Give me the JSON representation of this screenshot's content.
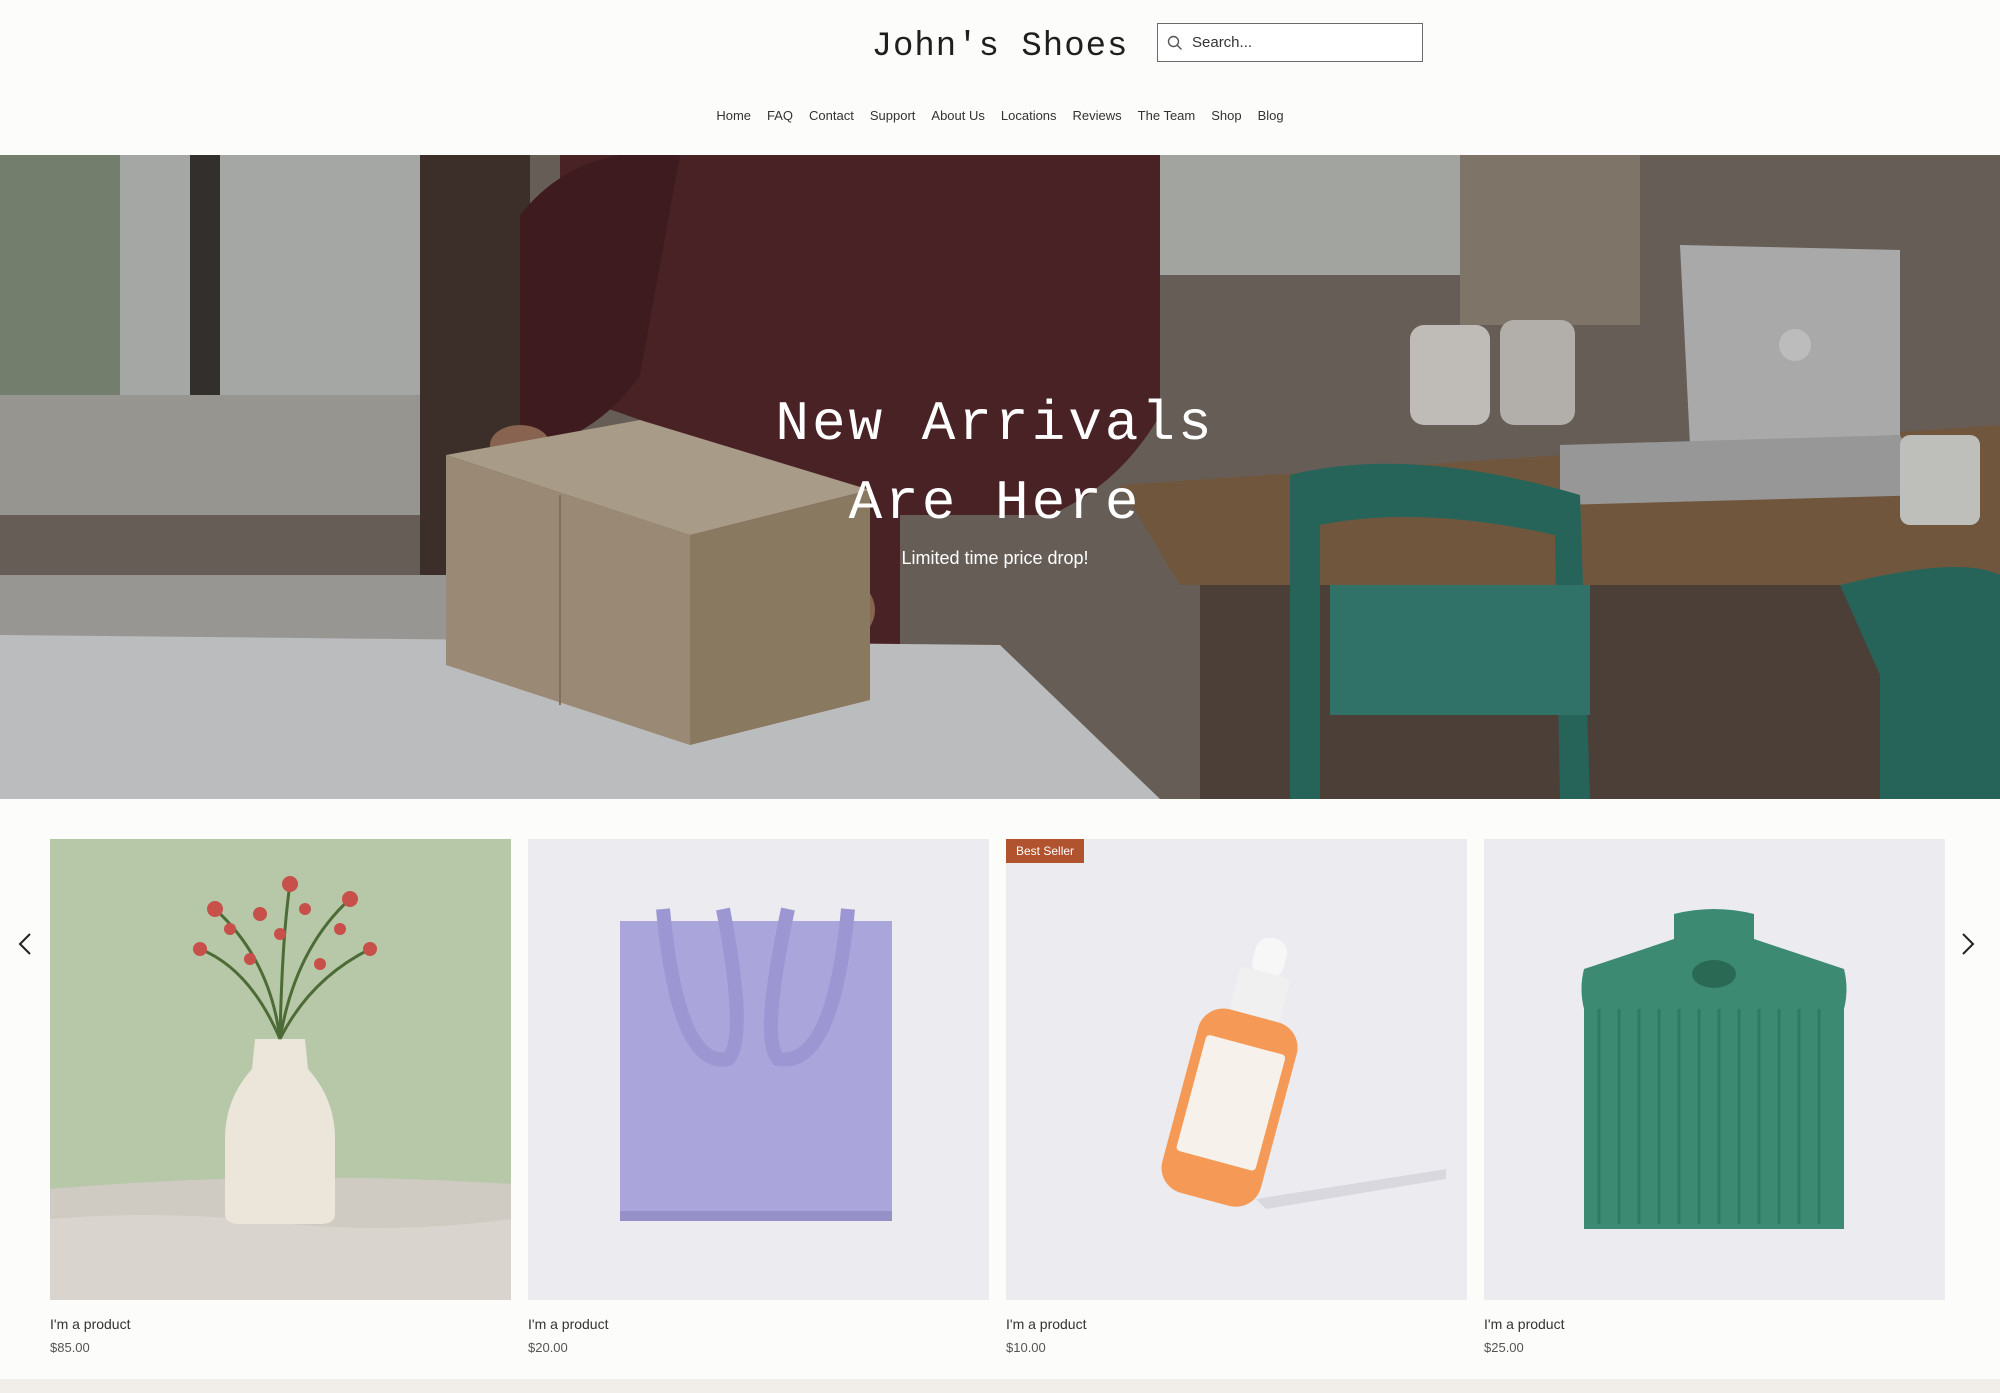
{
  "header": {
    "brand": "John's Shoes",
    "search_placeholder": "Search..."
  },
  "nav": [
    "Home",
    "FAQ",
    "Contact",
    "Support",
    "About Us",
    "Locations",
    "Reviews",
    "The Team",
    "Shop",
    "Blog"
  ],
  "hero": {
    "title": "New Arrivals\nAre Here",
    "subtitle": "Limited time price drop!"
  },
  "products": [
    {
      "name": "I'm a product",
      "price": "$85.00",
      "badge": "",
      "image": "vase-with-flowers"
    },
    {
      "name": "I'm a product",
      "price": "$20.00",
      "badge": "",
      "image": "tote-bag"
    },
    {
      "name": "I'm a product",
      "price": "$10.00",
      "badge": "Best Seller",
      "image": "dropper-bottle"
    },
    {
      "name": "I'm a product",
      "price": "$25.00",
      "badge": "",
      "image": "knit-sweater"
    }
  ],
  "colors": {
    "badge": "#b0532e",
    "page_bg": "#fcfcfa"
  },
  "icons": {
    "search": "search-icon",
    "prev": "chevron-left-icon",
    "next": "chevron-right-icon"
  }
}
